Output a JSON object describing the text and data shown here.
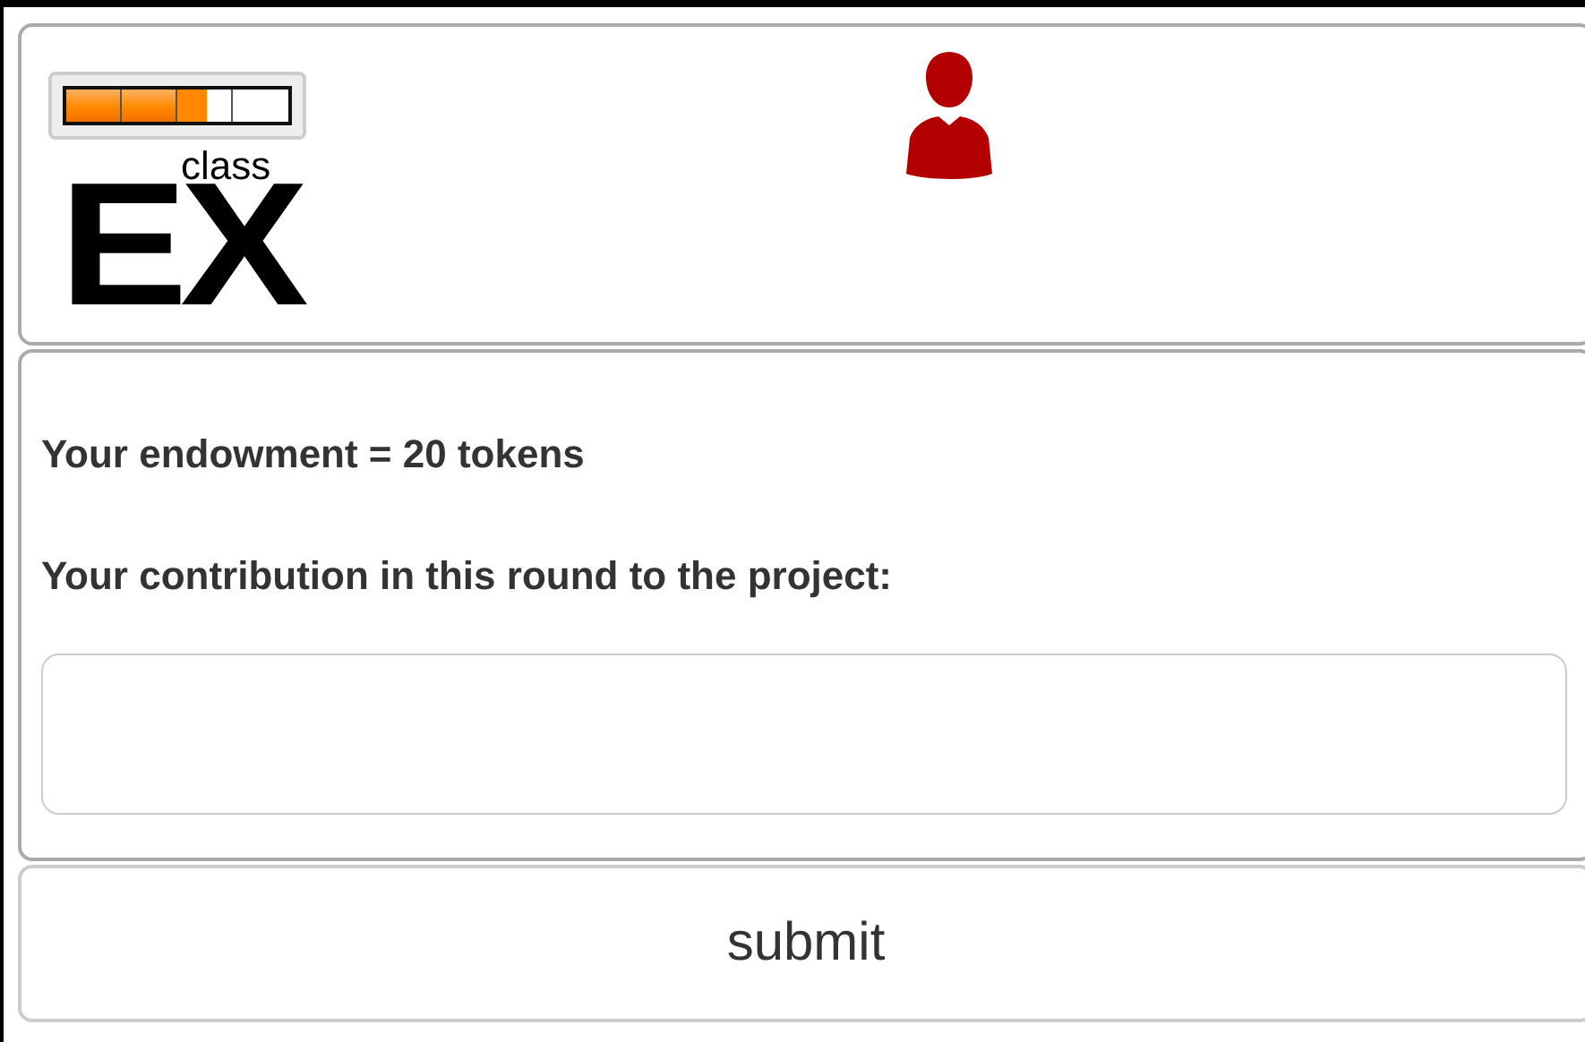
{
  "logo": {
    "superscript": "class",
    "letters": "EX"
  },
  "form": {
    "endowment": "Your endowment = 20 tokens",
    "question": "Your contribution in this round to the project:"
  },
  "submit": {
    "label": "submit"
  }
}
